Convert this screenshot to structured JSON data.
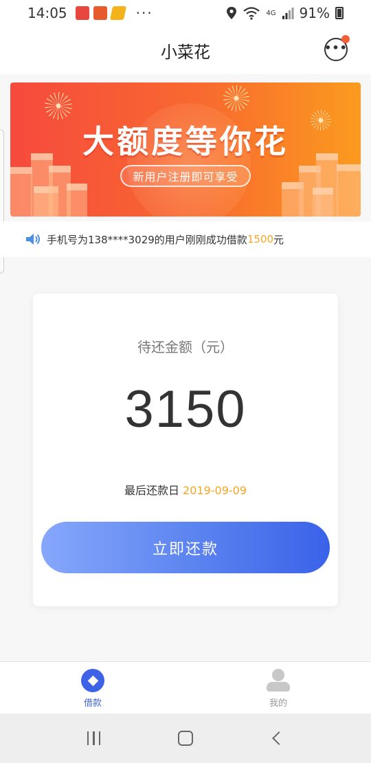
{
  "status_bar": {
    "time": "14:05",
    "more": "···",
    "network": "4G",
    "battery": "91%"
  },
  "header": {
    "title": "小菜花"
  },
  "banner": {
    "title": "大额度等你花",
    "subtitle": "新用户注册即可享受"
  },
  "notice": {
    "text_before": "手机号为138****3029的用户刚刚成功借款",
    "amount": "1500",
    "text_after": "元"
  },
  "card": {
    "label": "待还金额（元）",
    "amount": "3150",
    "due_label": "最后还款日 ",
    "due_date": "2019-09-09",
    "button_label": "立即还款"
  },
  "bottom_nav": {
    "items": [
      {
        "label": "借款",
        "active": true
      },
      {
        "label": "我的",
        "active": false
      }
    ]
  },
  "colors": {
    "accent": "#3e63e6",
    "highlight": "#f5a623",
    "banner_start": "#f64a3d",
    "banner_end": "#fb9b1f"
  }
}
